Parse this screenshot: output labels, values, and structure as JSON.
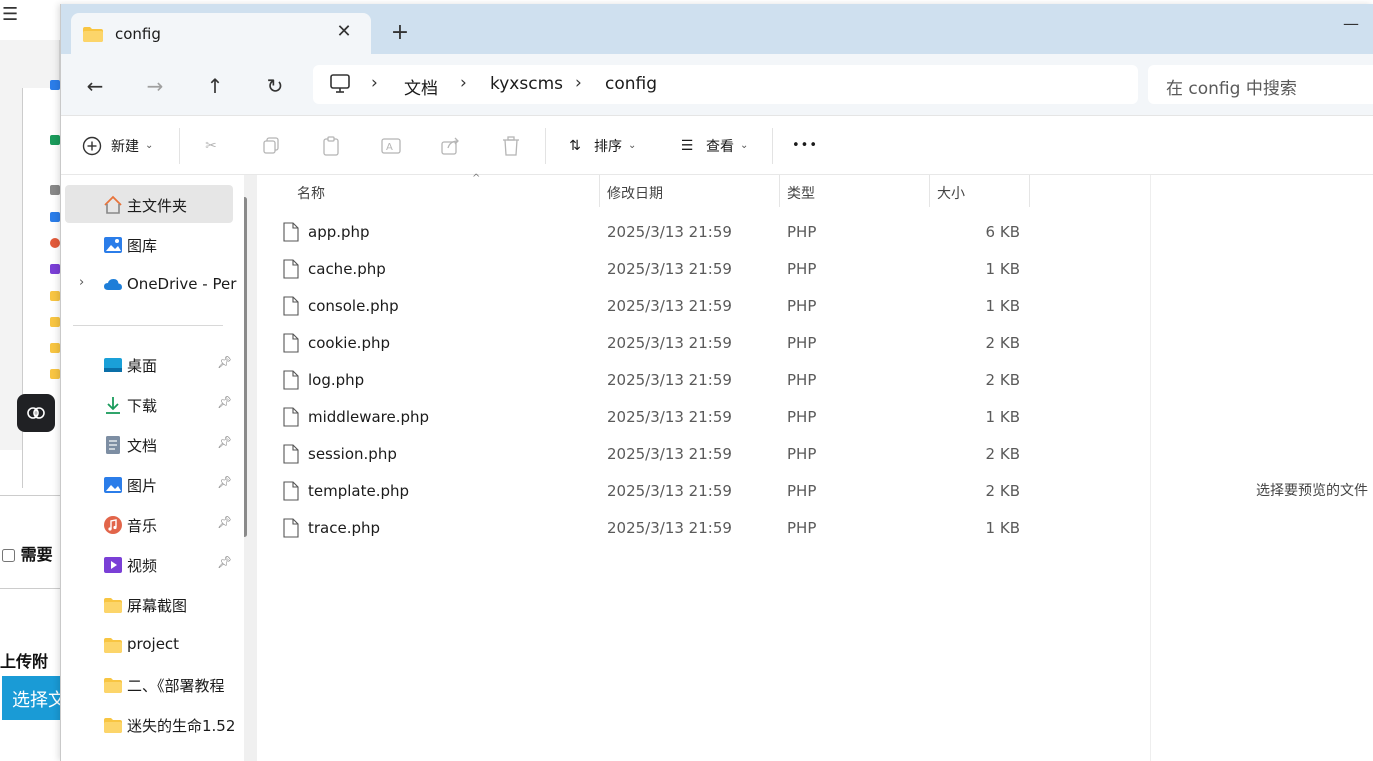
{
  "background_page": {
    "checkbox_label": "需要",
    "upload_label": "上传附",
    "choose_button": "选择文"
  },
  "tab": {
    "title": "config",
    "close_icon": "close-icon",
    "new_tab_icon": "plus-icon"
  },
  "nav": {
    "back_icon": "arrow-left-icon",
    "forward_icon": "arrow-right-icon",
    "up_icon": "arrow-up-icon",
    "refresh_icon": "refresh-icon"
  },
  "breadcrumb": [
    "文档",
    "kyxscms",
    "config"
  ],
  "search": {
    "placeholder": "在 config 中搜索"
  },
  "toolbar": {
    "new_label": "新建",
    "sort_label": "排序",
    "view_label": "查看",
    "more_label": "•••"
  },
  "sidebar": {
    "top": [
      {
        "label": "主文件夹",
        "icon": "home-icon"
      },
      {
        "label": "图库",
        "icon": "gallery-icon"
      },
      {
        "label": "OneDrive - Per",
        "icon": "cloud-icon"
      }
    ],
    "pinned": [
      {
        "label": "桌面",
        "icon": "desktop-icon"
      },
      {
        "label": "下载",
        "icon": "download-icon"
      },
      {
        "label": "文档",
        "icon": "document-icon"
      },
      {
        "label": "图片",
        "icon": "picture-icon"
      },
      {
        "label": "音乐",
        "icon": "music-icon"
      },
      {
        "label": "视频",
        "icon": "video-icon"
      },
      {
        "label": "屏幕截图",
        "icon": "folder-icon"
      },
      {
        "label": "project",
        "icon": "folder-icon"
      },
      {
        "label": "二、《部署教程",
        "icon": "folder-icon"
      },
      {
        "label": "迷失的生命1.52",
        "icon": "folder-icon"
      }
    ]
  },
  "columns": {
    "name": "名称",
    "date": "修改日期",
    "type": "类型",
    "size": "大小"
  },
  "files": [
    {
      "name": "app.php",
      "date": "2025/3/13 21:59",
      "type": "PHP",
      "size": "6 KB"
    },
    {
      "name": "cache.php",
      "date": "2025/3/13 21:59",
      "type": "PHP",
      "size": "1 KB"
    },
    {
      "name": "console.php",
      "date": "2025/3/13 21:59",
      "type": "PHP",
      "size": "1 KB"
    },
    {
      "name": "cookie.php",
      "date": "2025/3/13 21:59",
      "type": "PHP",
      "size": "2 KB"
    },
    {
      "name": "log.php",
      "date": "2025/3/13 21:59",
      "type": "PHP",
      "size": "2 KB"
    },
    {
      "name": "middleware.php",
      "date": "2025/3/13 21:59",
      "type": "PHP",
      "size": "1 KB"
    },
    {
      "name": "session.php",
      "date": "2025/3/13 21:59",
      "type": "PHP",
      "size": "2 KB"
    },
    {
      "name": "template.php",
      "date": "2025/3/13 21:59",
      "type": "PHP",
      "size": "2 KB"
    },
    {
      "name": "trace.php",
      "date": "2025/3/13 21:59",
      "type": "PHP",
      "size": "1 KB"
    }
  ],
  "preview": {
    "message": "选择要预览的文件"
  },
  "colors": {
    "titlebar": "#cfe0ef",
    "folder": "#f8c542",
    "accent": "#0078d4"
  }
}
